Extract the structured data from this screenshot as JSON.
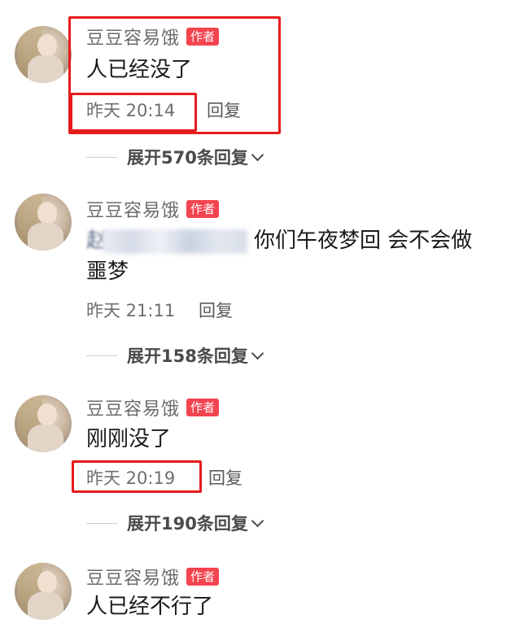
{
  "comments": [
    {
      "username": "豆豆容易饿",
      "badge": "作者",
      "content": "人已经没了",
      "time": "昨天 20:14",
      "reply": "回复",
      "expand": "展开570条回复"
    },
    {
      "username": "豆豆容易饿",
      "badge": "作者",
      "content_redacted_char": "赵",
      "content": "你们午夜梦回 会不会做",
      "content_line2": "噩梦",
      "time": "昨天 21:11",
      "reply": "回复",
      "expand": "展开158条回复"
    },
    {
      "username": "豆豆容易饿",
      "badge": "作者",
      "content": "刚刚没了",
      "time": "昨天 20:19",
      "reply": "回复",
      "expand": "展开190条回复"
    },
    {
      "username": "豆豆容易饿",
      "badge": "作者",
      "content": "人已经不行了"
    }
  ],
  "colors": {
    "author_badge": "#f3444f",
    "highlight_box": "#e61b1b",
    "username": "#6b6b6b",
    "meta": "#6e6e6e"
  }
}
